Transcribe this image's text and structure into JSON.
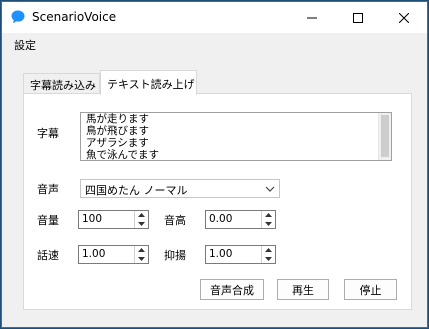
{
  "window": {
    "title": "ScenarioVoice"
  },
  "menu": {
    "settings_label": "設定"
  },
  "tabs": [
    {
      "label": "字幕読み込み",
      "active": false
    },
    {
      "label": "テキスト読み上げ",
      "active": true
    }
  ],
  "subtitle": {
    "label": "字幕",
    "text": "馬が走ります\n鳥が飛びます\nアザラシます\n魚で泳んでます"
  },
  "voice": {
    "label": "音声",
    "selected": "四国めたん ノーマル"
  },
  "volume": {
    "label": "音量",
    "value": "100"
  },
  "pitch": {
    "label": "音高",
    "value": "0.00"
  },
  "speed": {
    "label": "話速",
    "value": "1.00"
  },
  "intonation": {
    "label": "抑揚",
    "value": "1.00"
  },
  "buttons": {
    "synthesize": "音声合成",
    "play": "再生",
    "stop": "停止"
  },
  "colors": {
    "titlebar": "#ffffff",
    "accent": "#1e90ff",
    "panel": "#ffffff",
    "window": "#f0f0f0"
  }
}
